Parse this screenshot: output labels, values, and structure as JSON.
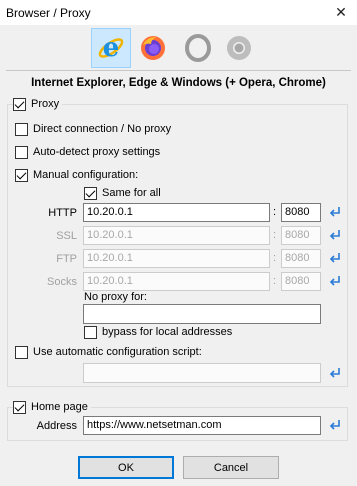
{
  "window": {
    "title": "Browser / Proxy"
  },
  "browser_tabs": [
    {
      "name": "internet-explorer-edge-icon",
      "active": true
    },
    {
      "name": "firefox-icon",
      "active": false
    },
    {
      "name": "opera-icon",
      "active": false
    },
    {
      "name": "chrome-icon",
      "active": false
    }
  ],
  "heading": "Internet Explorer, Edge & Windows (+ Opera, Chrome)",
  "proxy": {
    "label": "Proxy",
    "checked": true,
    "direct_label": "Direct connection / No proxy",
    "direct_checked": false,
    "autodetect_label": "Auto-detect proxy settings",
    "autodetect_checked": false,
    "manual_label": "Manual configuration:",
    "manual_checked": true,
    "same_for_all_label": "Same for all",
    "same_for_all_checked": true,
    "servers": [
      {
        "label": "HTTP",
        "address": "10.20.0.1",
        "port": "8080",
        "enabled": true
      },
      {
        "label": "SSL",
        "address": "10.20.0.1",
        "port": "8080",
        "enabled": false
      },
      {
        "label": "FTP",
        "address": "10.20.0.1",
        "port": "8080",
        "enabled": false
      },
      {
        "label": "Socks",
        "address": "10.20.0.1",
        "port": "8080",
        "enabled": false
      }
    ],
    "colon": ":",
    "no_proxy_label": "No proxy for:",
    "no_proxy_value": "",
    "bypass_label": "bypass for local addresses",
    "bypass_checked": false,
    "auto_script_label": "Use automatic configuration script:",
    "auto_script_checked": false,
    "auto_script_value": ""
  },
  "homepage": {
    "label": "Home page",
    "checked": true,
    "address_label": "Address",
    "address_value": "https://www.netsetman.com"
  },
  "buttons": {
    "ok": "OK",
    "cancel": "Cancel"
  },
  "colors": {
    "accent": "#0078d7",
    "arrow_icon": "#2b7bd6"
  }
}
